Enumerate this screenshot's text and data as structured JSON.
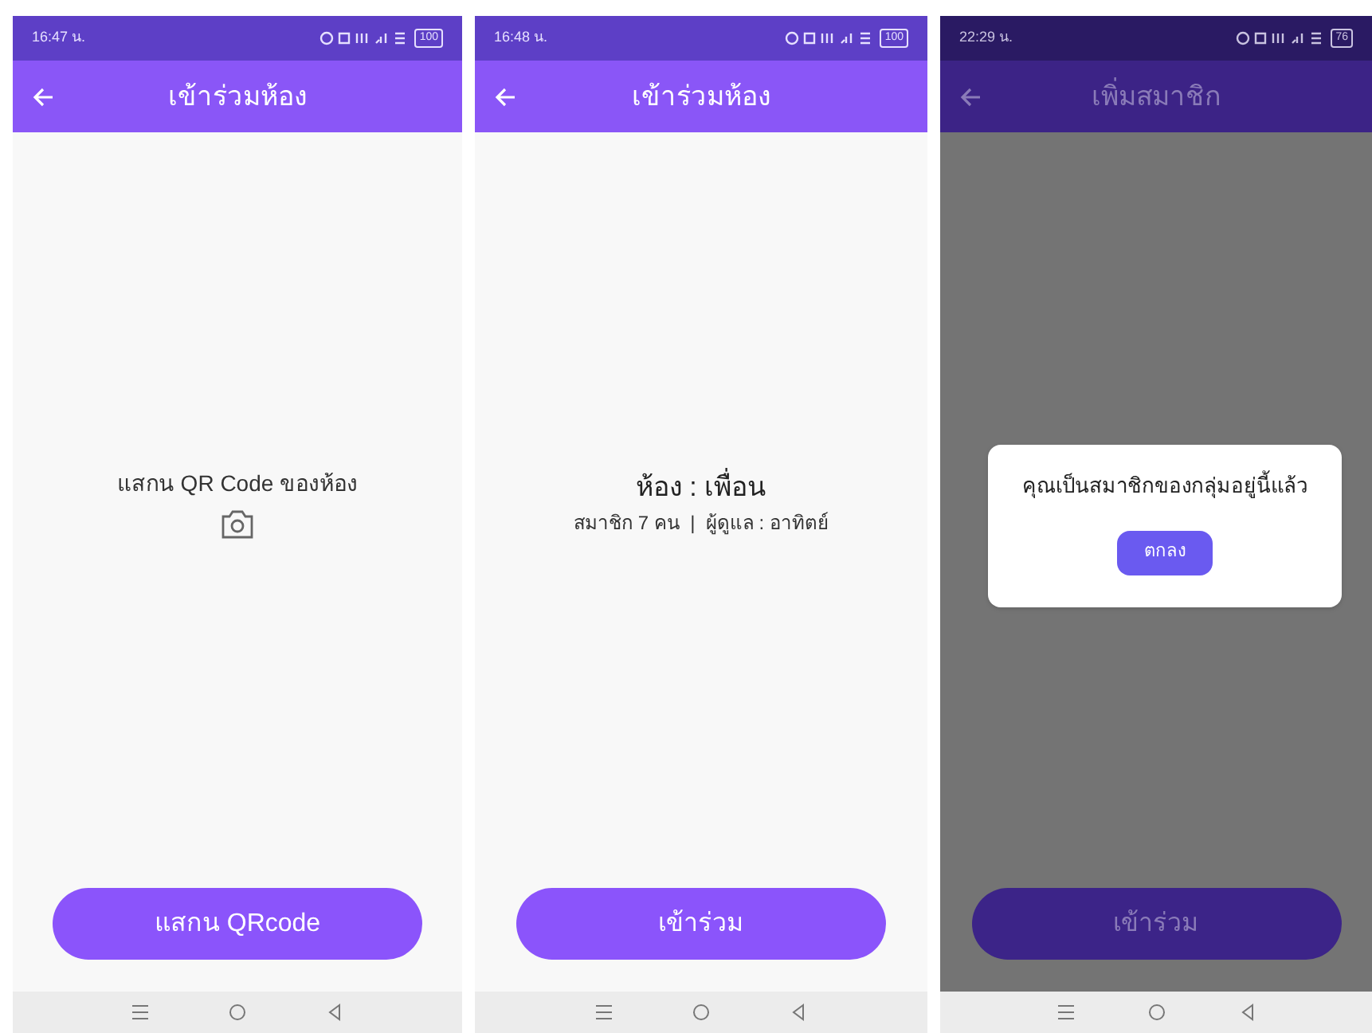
{
  "screens": [
    {
      "kind": "scan",
      "dimmed": false,
      "status_bar": {
        "time": "16:47 น.",
        "battery": "100"
      },
      "app_bar": {
        "title": "เข้าร่วมห้อง"
      },
      "content": {
        "prompt": "แสกน QR Code ของห้อง"
      },
      "button": {
        "label": "แสกน QRcode"
      }
    },
    {
      "kind": "room",
      "dimmed": false,
      "status_bar": {
        "time": "16:48 น.",
        "battery": "100"
      },
      "app_bar": {
        "title": "เข้าร่วมห้อง"
      },
      "content": {
        "room_name": "ห้อง : เพื่อน",
        "details": "สมาชิก 7 คน  |  ผู้ดูแล : อาทิตย์"
      },
      "button": {
        "label": "เข้าร่วม"
      }
    },
    {
      "kind": "room",
      "dimmed": true,
      "status_bar": {
        "time": "22:29 น.",
        "battery": "76"
      },
      "app_bar": {
        "title": "เพิ่มสมาชิก"
      },
      "button": {
        "label": "เข้าร่วม"
      },
      "dialog": {
        "message": "คุณเป็นสมาชิกของกลุ่มอยู่นี้แล้ว",
        "button": "ตกลง"
      }
    }
  ]
}
